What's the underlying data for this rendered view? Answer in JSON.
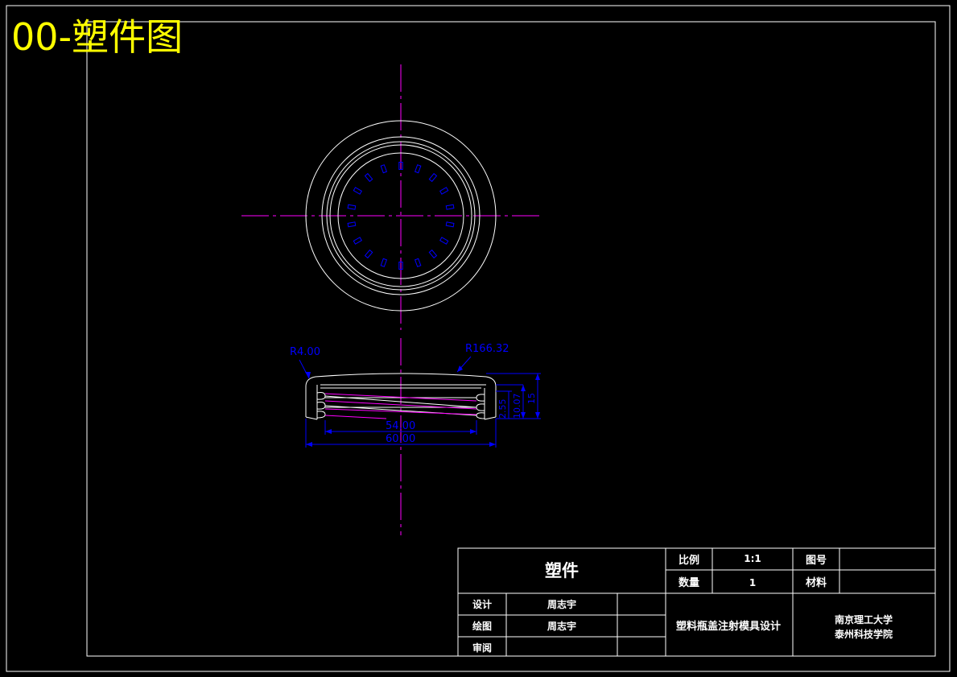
{
  "sheet": {
    "heading": "00-塑件图",
    "colors": {
      "background": "#000000",
      "outline": "#ffffff",
      "centerline": "#ff00ff",
      "dimension": "#0000ff",
      "heading": "#ffff00"
    }
  },
  "dimensions": {
    "corner_radius": "R4.00",
    "top_radius": "R166.32",
    "inner_diameter": "54.00",
    "outer_diameter": "60.00",
    "height_small": "2.55",
    "height_mid": "10.07",
    "height_total": "15"
  },
  "title_block": {
    "part_name": "塑件",
    "scale_label": "比例",
    "scale_value": "1:1",
    "drawing_no_label": "图号",
    "drawing_no_value": "",
    "qty_label": "数量",
    "qty_value": "1",
    "material_label": "材料",
    "material_value": "",
    "designer_label": "设计",
    "designer_name": "周志宇",
    "drafter_label": "绘图",
    "drafter_name": "周志宇",
    "reviewer_label": "审阅",
    "reviewer_name": "",
    "project_title": "塑料瓶盖注射模具设计",
    "school_line1": "南京理工大学",
    "school_line2": "泰州科技学院"
  }
}
